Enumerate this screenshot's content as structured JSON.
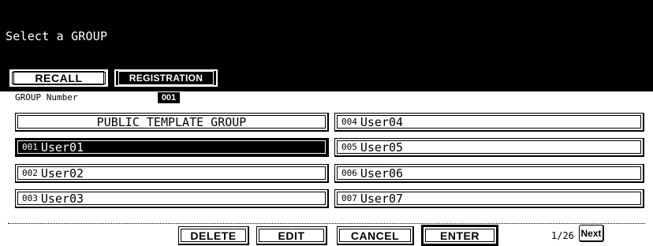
{
  "header": {
    "title": "Select a GROUP"
  },
  "tabs": {
    "recall": "RECALL",
    "registration": "REGISTRATION"
  },
  "group": {
    "label": "GROUP Number",
    "value": "001"
  },
  "items_left": [
    {
      "num": "",
      "name": "PUBLIC TEMPLATE GROUP",
      "selected": false
    },
    {
      "num": "001",
      "name": "User01",
      "selected": true
    },
    {
      "num": "002",
      "name": "User02",
      "selected": false
    },
    {
      "num": "003",
      "name": "User03",
      "selected": false
    }
  ],
  "items_right": [
    {
      "num": "004",
      "name": "User04",
      "selected": false
    },
    {
      "num": "005",
      "name": "User05",
      "selected": false
    },
    {
      "num": "006",
      "name": "User06",
      "selected": false
    },
    {
      "num": "007",
      "name": "User07",
      "selected": false
    }
  ],
  "actions": {
    "delete": "DELETE",
    "edit": "EDIT",
    "cancel": "CANCEL",
    "enter": "ENTER"
  },
  "pagination": {
    "page": "1/26",
    "next": "Next"
  }
}
